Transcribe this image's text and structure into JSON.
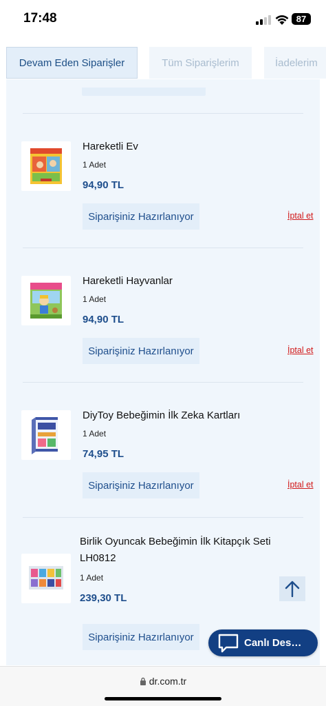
{
  "status_bar": {
    "time": "17:48",
    "battery": "87"
  },
  "tabs": [
    {
      "label": "Devam Eden Siparişler",
      "active": true
    },
    {
      "label": "Tüm Siparişlerim",
      "active": false
    },
    {
      "label": "İadelerim",
      "active": false
    }
  ],
  "orders": [
    {
      "name": "Hareketli Ev",
      "quantity": "1 Adet",
      "price": "94,90 TL",
      "status": "Siparişiniz Hazırlanıyor",
      "cancel": "İptal et",
      "thumb_icon": "book-cover-house"
    },
    {
      "name": "Hareketli Hayvanlar",
      "quantity": "1 Adet",
      "price": "94,90 TL",
      "status": "Siparişiniz Hazırlanıyor",
      "cancel": "İptal et",
      "thumb_icon": "book-cover-animals"
    },
    {
      "name": "DiyToy Bebeğimin İlk Zeka Kartları",
      "quantity": "1 Adet",
      "price": "74,95 TL",
      "status": "Siparişiniz Hazırlanıyor",
      "cancel": "İptal et",
      "thumb_icon": "card-box"
    },
    {
      "name_line1": "Birlik Oyuncak Bebeğimin İlk Kitapçık Seti",
      "name_line2": "LH0812",
      "quantity": "1 Adet",
      "price": "239,30 TL",
      "status": "Siparişiniz Hazırlanıyor",
      "thumb_icon": "booklet-set"
    }
  ],
  "live_chat": {
    "label": "Canlı Des…"
  },
  "browser": {
    "url": "dr.com.tr"
  },
  "colors": {
    "accent": "#1e4e8c",
    "panel_bg": "#f0f6fc",
    "button_bg": "#e3eef9",
    "cancel_red": "#d11a1a",
    "chat_bg": "#123f83"
  }
}
